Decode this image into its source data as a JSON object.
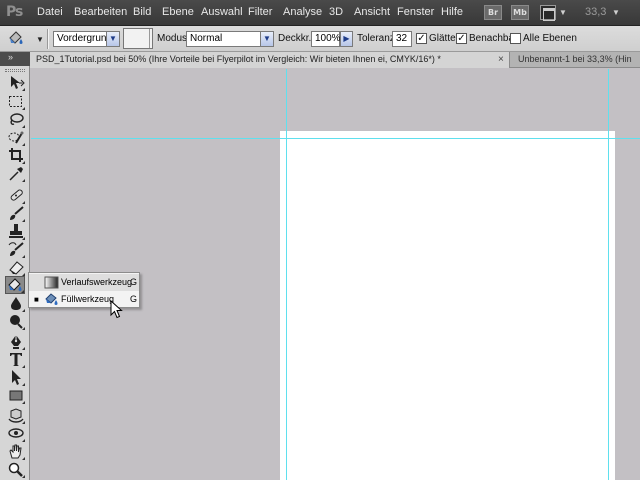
{
  "app": {
    "logo_text": "Ps"
  },
  "menu": {
    "items": [
      "Datei",
      "Bearbeiten",
      "Bild",
      "Ebene",
      "Auswahl",
      "Filter",
      "Analyse",
      "3D",
      "Ansicht",
      "Fenster",
      "Hilfe"
    ],
    "bridge_label": "Br",
    "minibridge_label": "Mb",
    "zoom": "33,3"
  },
  "options": {
    "fill_source": "Vordergrund",
    "mode_label": "Modus:",
    "mode_value": "Normal",
    "opacity_label": "Deckkr.:",
    "opacity_value": "100%",
    "tolerance_label": "Toleranz:",
    "tolerance_value": "32",
    "antialias_label": "Glätten",
    "antialias_checked": true,
    "contiguous_label": "Benachbart",
    "contiguous_checked": true,
    "all_layers_label": "Alle Ebenen",
    "all_layers_checked": false
  },
  "tabs": {
    "active": "PSD_1Tutorial.psd bei 50% (Ihre Vorteile bei Flyerpilot im Vergleich:  Wir bieten Ihnen ei, CMYK/16*) *",
    "inactive": "Unbenannt-1 bei 33,3% (Hin"
  },
  "flyout": {
    "items": [
      {
        "label": "Verlaufswerkzeug",
        "shortcut": "G",
        "icon": "gradient-icon",
        "selected": false
      },
      {
        "label": "Füllwerkzeug",
        "shortcut": "G",
        "icon": "paint-bucket-icon",
        "selected": true
      }
    ]
  },
  "tools": [
    "move-tool-icon",
    "marquee-tool-icon",
    "lasso-tool-icon",
    "quick-selection-tool-icon",
    "crop-tool-icon",
    "eyedropper-tool-icon",
    "spot-healing-tool-icon",
    "brush-tool-icon",
    "clone-stamp-tool-icon",
    "history-brush-tool-icon",
    "eraser-tool-icon",
    "paint-bucket-tool-icon",
    "blur-tool-icon",
    "dodge-tool-icon",
    "pen-tool-icon",
    "type-tool-icon",
    "path-selection-tool-icon",
    "rectangle-tool-icon",
    "3d-rotate-tool-icon",
    "3d-orbit-tool-icon",
    "hand-tool-icon",
    "zoom-tool-icon"
  ],
  "colors": {
    "guide": "#5fe0ee",
    "workspace": "#c3c0c4",
    "menubar": "#3d3d3d",
    "canvas": "#ffffff"
  }
}
